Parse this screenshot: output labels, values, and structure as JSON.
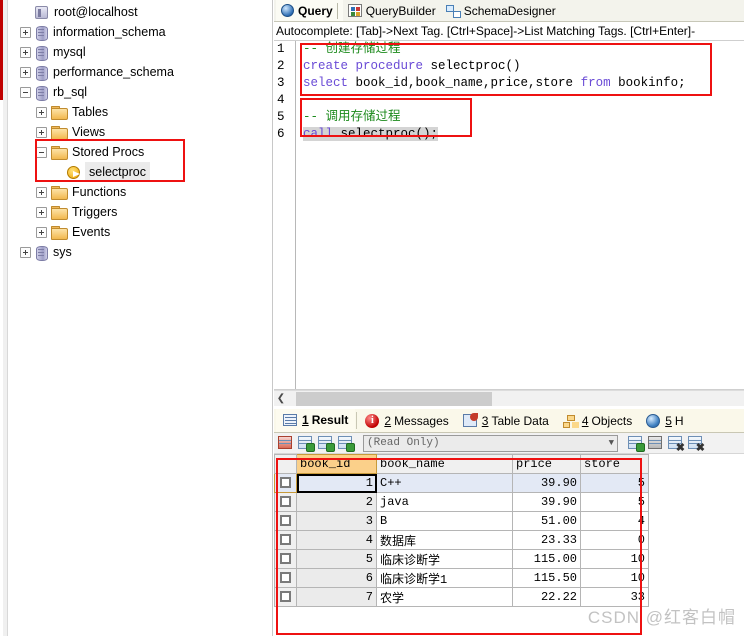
{
  "tree": {
    "root": {
      "label": "root@localhost",
      "icon": "server-icon"
    },
    "items": [
      {
        "label": "information_schema",
        "icon": "database-icon",
        "indent": 0,
        "expander": "plus"
      },
      {
        "label": "mysql",
        "icon": "database-icon",
        "indent": 0,
        "expander": "plus"
      },
      {
        "label": "performance_schema",
        "icon": "database-icon",
        "indent": 0,
        "expander": "plus"
      },
      {
        "label": "rb_sql",
        "icon": "database-icon",
        "indent": 0,
        "expander": "minus"
      },
      {
        "label": "Tables",
        "icon": "folder-icon",
        "indent": 1,
        "expander": "plus"
      },
      {
        "label": "Views",
        "icon": "folder-icon",
        "indent": 1,
        "expander": "plus"
      },
      {
        "label": "Stored Procs",
        "icon": "folder-icon",
        "indent": 1,
        "expander": "minus"
      },
      {
        "label": "selectproc",
        "icon": "stored-procedure-icon",
        "indent": 2,
        "expander": "none",
        "selected": true
      },
      {
        "label": "Functions",
        "icon": "folder-icon",
        "indent": 1,
        "expander": "plus"
      },
      {
        "label": "Triggers",
        "icon": "folder-icon",
        "indent": 1,
        "expander": "plus"
      },
      {
        "label": "Events",
        "icon": "folder-icon",
        "indent": 1,
        "expander": "plus"
      },
      {
        "label": "sys",
        "icon": "database-icon",
        "indent": 0,
        "expander": "plus"
      }
    ]
  },
  "top_tabs": [
    {
      "label": "Query",
      "icon": "query-icon",
      "active": true
    },
    {
      "label": "QueryBuilder",
      "icon": "query-builder-icon",
      "active": false
    },
    {
      "label": "SchemaDesigner",
      "icon": "schema-designer-icon",
      "active": false
    }
  ],
  "autocomplete_hint": "Autocomplete: [Tab]->Next Tag. [Ctrl+Space]->List Matching Tags. [Ctrl+Enter]-",
  "editor": {
    "line_numbers": [
      "1",
      "2",
      "3",
      "4",
      "5",
      "6"
    ],
    "lines": [
      {
        "n": "1",
        "segments": [
          {
            "t": "-- 创建存储过程",
            "c": "cm"
          }
        ]
      },
      {
        "n": "2",
        "segments": [
          {
            "t": "create procedure",
            "c": "kw"
          },
          {
            "t": " selectproc()",
            "c": "pl"
          }
        ]
      },
      {
        "n": "3",
        "segments": [
          {
            "t": "select",
            "c": "kw"
          },
          {
            "t": " book_id,book_name,price,store ",
            "c": "pl"
          },
          {
            "t": "from",
            "c": "kw"
          },
          {
            "t": " bookinfo;",
            "c": "pl"
          }
        ]
      },
      {
        "n": "4",
        "segments": [
          {
            "t": "",
            "c": "pl"
          }
        ]
      },
      {
        "n": "5",
        "segments": [
          {
            "t": "-- 调用存储过程",
            "c": "cm"
          }
        ]
      },
      {
        "n": "6",
        "segments": [
          {
            "t": "call",
            "c": "kw sel-code"
          },
          {
            "t": " selectproc();",
            "c": "pl sel-code"
          }
        ]
      }
    ]
  },
  "result_tabs": [
    {
      "num": "1",
      "label": "Result",
      "icon": "result-grid-icon",
      "active": true
    },
    {
      "num": "2",
      "label": "Messages",
      "icon": "messages-info-icon",
      "active": false
    },
    {
      "num": "3",
      "label": "Table Data",
      "icon": "table-data-icon",
      "active": false
    },
    {
      "num": "4",
      "label": "Objects",
      "icon": "objects-tree-icon",
      "active": false
    },
    {
      "num": "5",
      "label": "H",
      "icon": "history-globe-icon",
      "active": false
    }
  ],
  "grid_toolbar": {
    "mode_value": "(Read Only)",
    "buttons": [
      {
        "name": "refresh-grid-icon"
      },
      {
        "name": "insert-row-icon"
      },
      {
        "name": "edit-row-icon"
      },
      {
        "name": "duplicate-row-icon"
      },
      {
        "name": "add-record-icon"
      },
      {
        "name": "save-record-icon"
      },
      {
        "name": "delete-record-icon"
      },
      {
        "name": "clear-filter-icon"
      }
    ]
  },
  "grid": {
    "columns": [
      "book_id",
      "book_name",
      "price",
      "store"
    ],
    "selected_column": "book_id",
    "rows": [
      {
        "book_id": "1",
        "book_name": "C++",
        "price": "39.90",
        "store": "5"
      },
      {
        "book_id": "2",
        "book_name": "java",
        "price": "39.90",
        "store": "5"
      },
      {
        "book_id": "3",
        "book_name": "B",
        "price": "51.00",
        "store": "4"
      },
      {
        "book_id": "4",
        "book_name": "数据库",
        "price": "23.33",
        "store": "0"
      },
      {
        "book_id": "5",
        "book_name": "临床诊断学",
        "price": "115.00",
        "store": "10"
      },
      {
        "book_id": "6",
        "book_name": "临床诊断学1",
        "price": "115.50",
        "store": "10"
      },
      {
        "book_id": "7",
        "book_name": "农学",
        "price": "22.22",
        "store": "33"
      }
    ]
  },
  "watermark": "CSDN @红客白帽",
  "colors": {
    "highlight_box": "#ee1111",
    "selected_column": "#fbd08a",
    "keyword": "#6a4bd6",
    "comment": "#1c8a1c",
    "active_tab_bg": "#fdfbef"
  }
}
